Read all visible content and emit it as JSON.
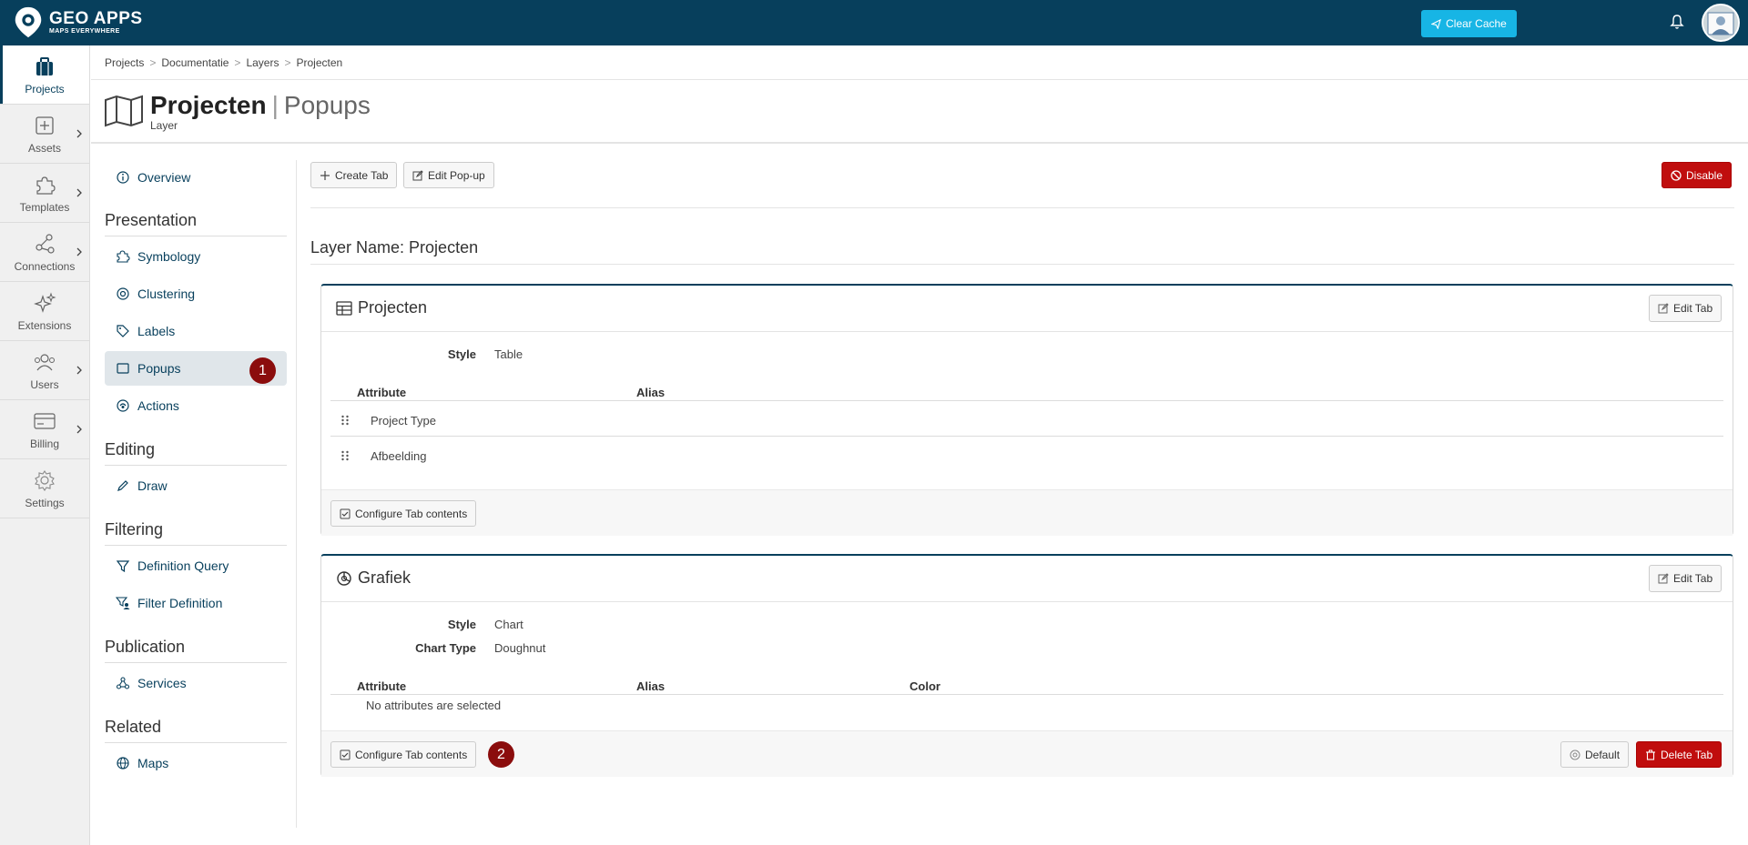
{
  "app": {
    "logo_title": "GEO APPS",
    "logo_subtitle": "MAPS EVERYWHERE",
    "clear_cache_label": "Clear Cache"
  },
  "leftnav": [
    {
      "label": "Projects",
      "icon": "briefcase-icon"
    },
    {
      "label": "Assets",
      "icon": "plus-square-icon"
    },
    {
      "label": "Templates",
      "icon": "puzzle-icon"
    },
    {
      "label": "Connections",
      "icon": "share-nodes-icon"
    },
    {
      "label": "Extensions",
      "icon": "sparkles-icon"
    },
    {
      "label": "Users",
      "icon": "users-icon"
    },
    {
      "label": "Billing",
      "icon": "credit-card-icon"
    },
    {
      "label": "Settings",
      "icon": "gear-icon"
    }
  ],
  "breadcrumb": [
    "Projects",
    "Documentatie",
    "Layers",
    "Projecten"
  ],
  "breadcrumb_sep": ">",
  "page": {
    "title": "Projecten",
    "section": "Popups",
    "pipe": "|",
    "subtitle": "Layer"
  },
  "sidemenu": {
    "overview": "Overview",
    "presentation_heading": "Presentation",
    "symbology": "Symbology",
    "clustering": "Clustering",
    "labels": "Labels",
    "popups": "Popups",
    "actions": "Actions",
    "editing_heading": "Editing",
    "draw": "Draw",
    "filtering_heading": "Filtering",
    "definition_query": "Definition Query",
    "filter_definition": "Filter Definition",
    "publication_heading": "Publication",
    "services": "Services",
    "related_heading": "Related",
    "maps": "Maps"
  },
  "badges": {
    "one": "1",
    "two": "2"
  },
  "toolbar": {
    "create_tab": "Create Tab",
    "edit_popup": "Edit Pop-up",
    "disable": "Disable"
  },
  "layer_name": "Layer Name: Projecten",
  "cards": {
    "projecten": {
      "title": "Projecten",
      "style_label": "Style",
      "style_value": "Table",
      "edit_tab": "Edit Tab",
      "col_attribute": "Attribute",
      "col_alias": "Alias",
      "rows": [
        "Project Type",
        "Afbeelding"
      ],
      "configure": "Configure Tab contents"
    },
    "grafiek": {
      "title": "Grafiek",
      "style_label": "Style",
      "style_value": "Chart",
      "charttype_label": "Chart Type",
      "charttype_value": "Doughnut",
      "edit_tab": "Edit Tab",
      "col_attribute": "Attribute",
      "col_alias": "Alias",
      "col_color": "Color",
      "empty": "No attributes are selected",
      "configure": "Configure Tab contents",
      "default": "Default",
      "delete_tab": "Delete Tab"
    }
  },
  "colors": {
    "topbar": "#073f5c",
    "accent_cyan": "#17b5e5",
    "danger": "#c00d0d",
    "badge": "#8b0d0d"
  }
}
